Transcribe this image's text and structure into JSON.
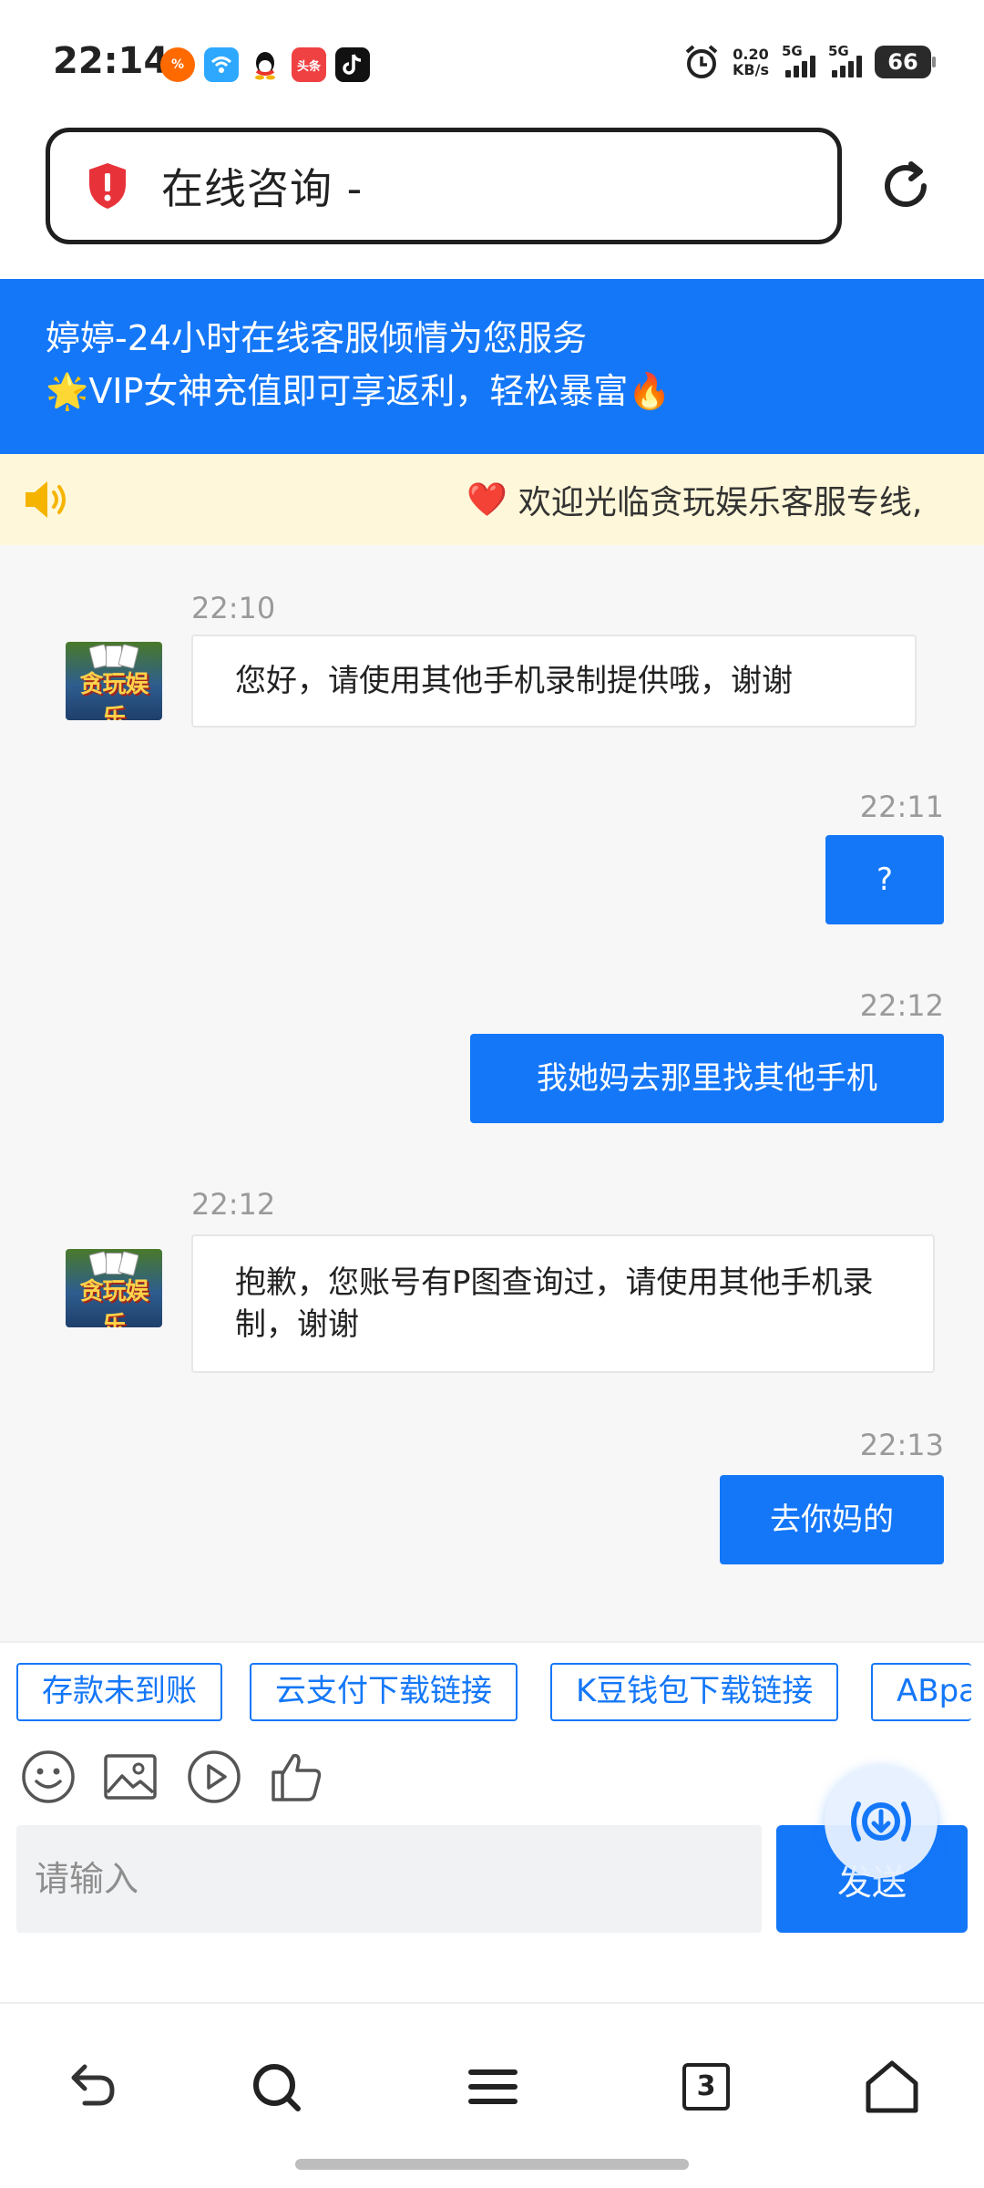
{
  "status_bar": {
    "time": "22:14",
    "app_icons": [
      "taobao-icon",
      "wifi-master-icon",
      "qq-icon",
      "toutiao-icon",
      "tiktok-icon"
    ],
    "toutiao_label": "头条",
    "net_speed_value": "0.20",
    "net_speed_unit": "KB/s",
    "sim1_label": "5G",
    "sim2_label": "5G",
    "battery": "66"
  },
  "address_bar": {
    "title": "在线咨询 -"
  },
  "banner": {
    "line1": "婷婷-24小时在线客服倾情为您服务",
    "line2": "🌟VIP女神充值即可享返利，轻松暴富🔥"
  },
  "notice": {
    "heart": "❤️",
    "text": "欢迎光临贪玩娱乐客服专线,"
  },
  "avatar_logo_text": "贪玩娱乐",
  "messages": [
    {
      "time": "22:10",
      "text": "您好，请使用其他手机录制提供哦，谢谢"
    },
    {
      "time": "22:11",
      "text": "?"
    },
    {
      "time": "22:12",
      "text": "我她妈去那里找其他手机"
    },
    {
      "time": "22:12",
      "text": "抱歉，您账号有P图查询过，请使用其他手机录制，谢谢"
    },
    {
      "time": "22:13",
      "text": "去你妈的"
    }
  ],
  "quick_replies": [
    "存款未到账",
    "云支付下载链接",
    "K豆钱包下载链接",
    "ABpay"
  ],
  "composer": {
    "placeholder": "请输入",
    "send_label": "发送"
  },
  "browser_nav": {
    "tab_count": "3"
  },
  "colors": {
    "accent": "#1477f8",
    "notice_bg": "#fff7d9",
    "chat_bg": "#f7f7f8"
  }
}
